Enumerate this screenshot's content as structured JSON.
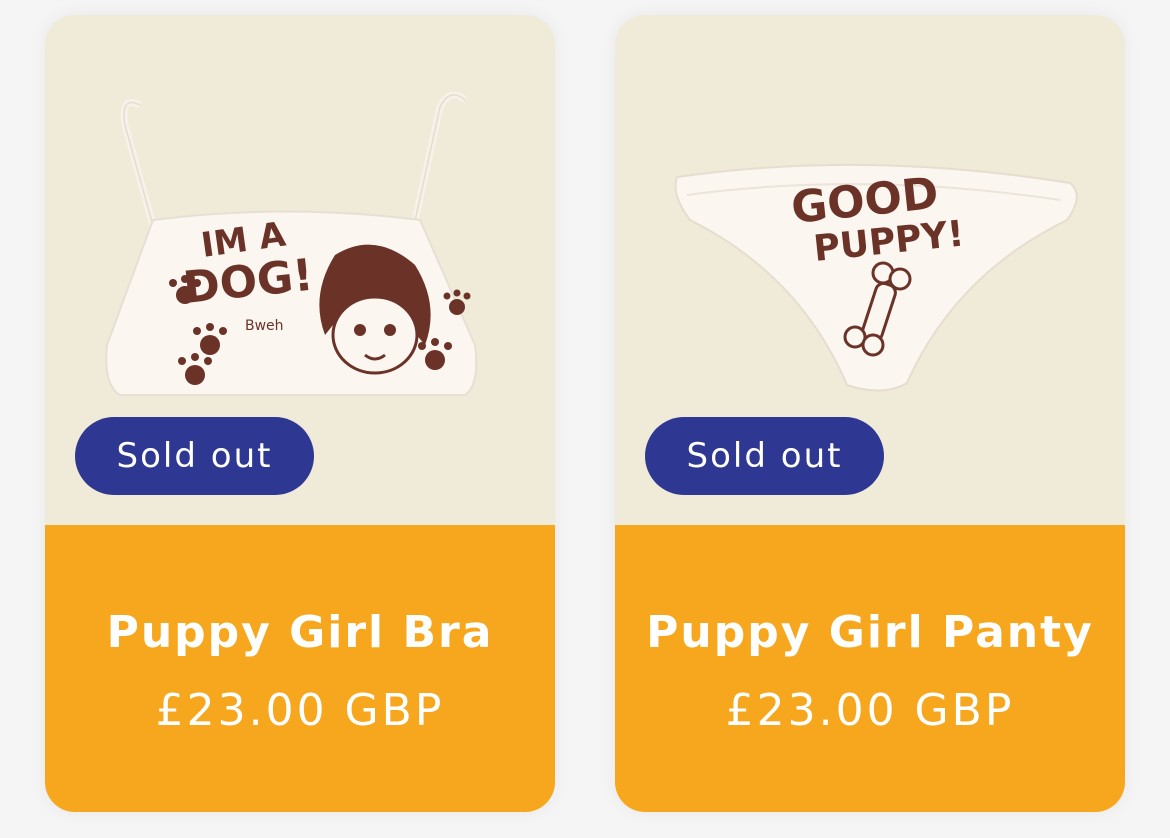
{
  "products": [
    {
      "badge": "Sold out",
      "title": "Puppy Girl Bra",
      "price": "£23.00 GBP",
      "image_icon": "bra-product-image"
    },
    {
      "badge": "Sold out",
      "title": "Puppy Girl Panty",
      "price": "£23.00 GBP",
      "image_icon": "panty-product-image"
    }
  ],
  "colors": {
    "image_background": "#efebd8",
    "info_background": "#f7a71d",
    "badge_background": "#2e3791",
    "text_on_color": "#ffffff",
    "print_brown": "#6b3228"
  }
}
